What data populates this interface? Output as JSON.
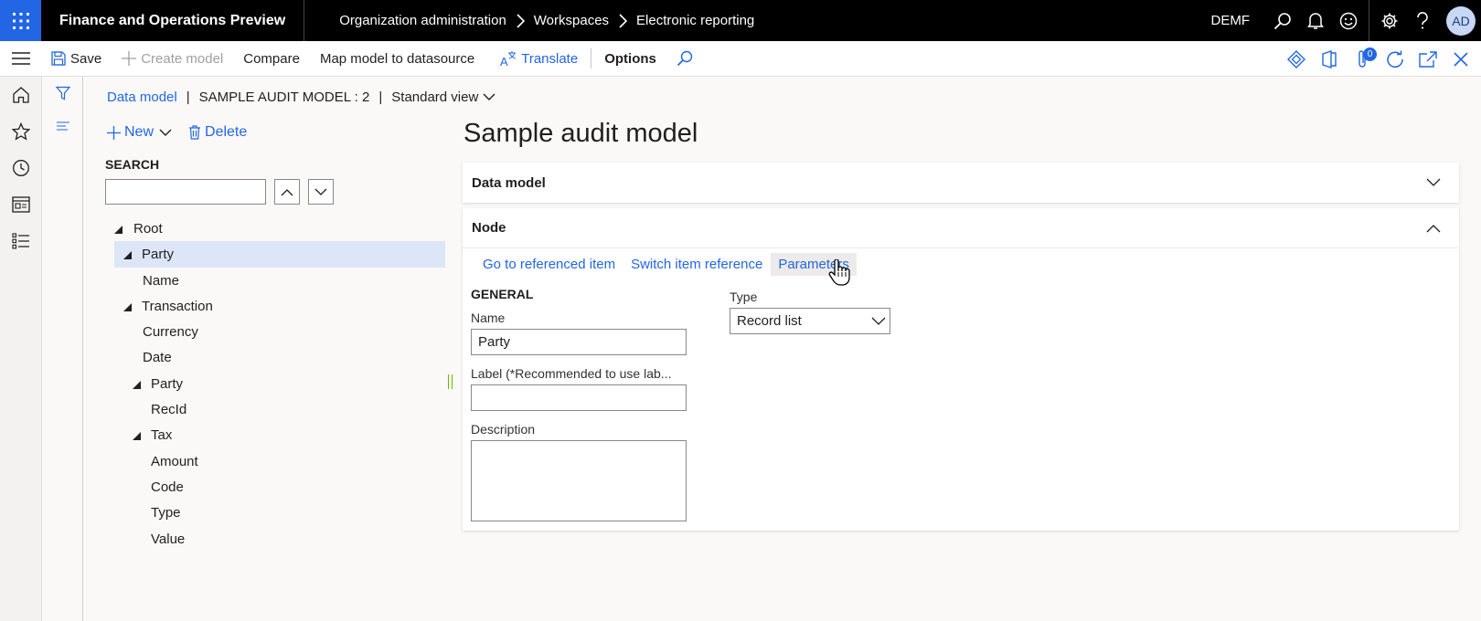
{
  "topbar": {
    "app_title": "Finance and Operations Preview",
    "breadcrumb": [
      "Organization administration",
      "Workspaces",
      "Electronic reporting"
    ],
    "company": "DEMF",
    "avatar_initials": "AD",
    "accent_color": "#2266e3"
  },
  "actionbar": {
    "save": "Save",
    "create_model": "Create model",
    "compare": "Compare",
    "map_model": "Map model to datasource",
    "translate": "Translate",
    "options": "Options",
    "attachments_count": "0"
  },
  "content_breadcrumb": {
    "root": "Data model",
    "current": "SAMPLE AUDIT MODEL : 2",
    "view": "Standard view"
  },
  "tree_toolbar": {
    "new": "New",
    "delete": "Delete"
  },
  "search": {
    "label": "SEARCH",
    "value": ""
  },
  "tree": [
    {
      "label": "Root",
      "level": 0,
      "expandable": true,
      "selected": false
    },
    {
      "label": "Party",
      "level": 1,
      "expandable": true,
      "selected": true
    },
    {
      "label": "Name",
      "level": 2,
      "expandable": false,
      "selected": false
    },
    {
      "label": "Transaction",
      "level": 1,
      "expandable": true,
      "selected": false
    },
    {
      "label": "Currency",
      "level": 2,
      "expandable": false,
      "selected": false
    },
    {
      "label": "Date",
      "level": 2,
      "expandable": false,
      "selected": false
    },
    {
      "label": "Party",
      "level": 2,
      "expandable": true,
      "selected": false
    },
    {
      "label": "RecId",
      "level": 3,
      "expandable": false,
      "selected": false
    },
    {
      "label": "Tax",
      "level": 2,
      "expandable": true,
      "selected": false
    },
    {
      "label": "Amount",
      "level": 3,
      "expandable": false,
      "selected": false
    },
    {
      "label": "Code",
      "level": 3,
      "expandable": false,
      "selected": false
    },
    {
      "label": "Type",
      "level": 3,
      "expandable": false,
      "selected": false
    },
    {
      "label": "Value",
      "level": 3,
      "expandable": false,
      "selected": false
    }
  ],
  "page": {
    "title": "Sample audit model"
  },
  "data_model_card": {
    "header": "Data model"
  },
  "node_card": {
    "header": "Node",
    "links": [
      "Go to referenced item",
      "Switch item reference",
      "Parameters"
    ],
    "general_title": "GENERAL",
    "name_label": "Name",
    "name_value": "Party",
    "label_label": "Label (*Recommended to use lab...",
    "label_value": "",
    "description_label": "Description",
    "description_value": "",
    "type_label": "Type",
    "type_value": "Record list"
  }
}
